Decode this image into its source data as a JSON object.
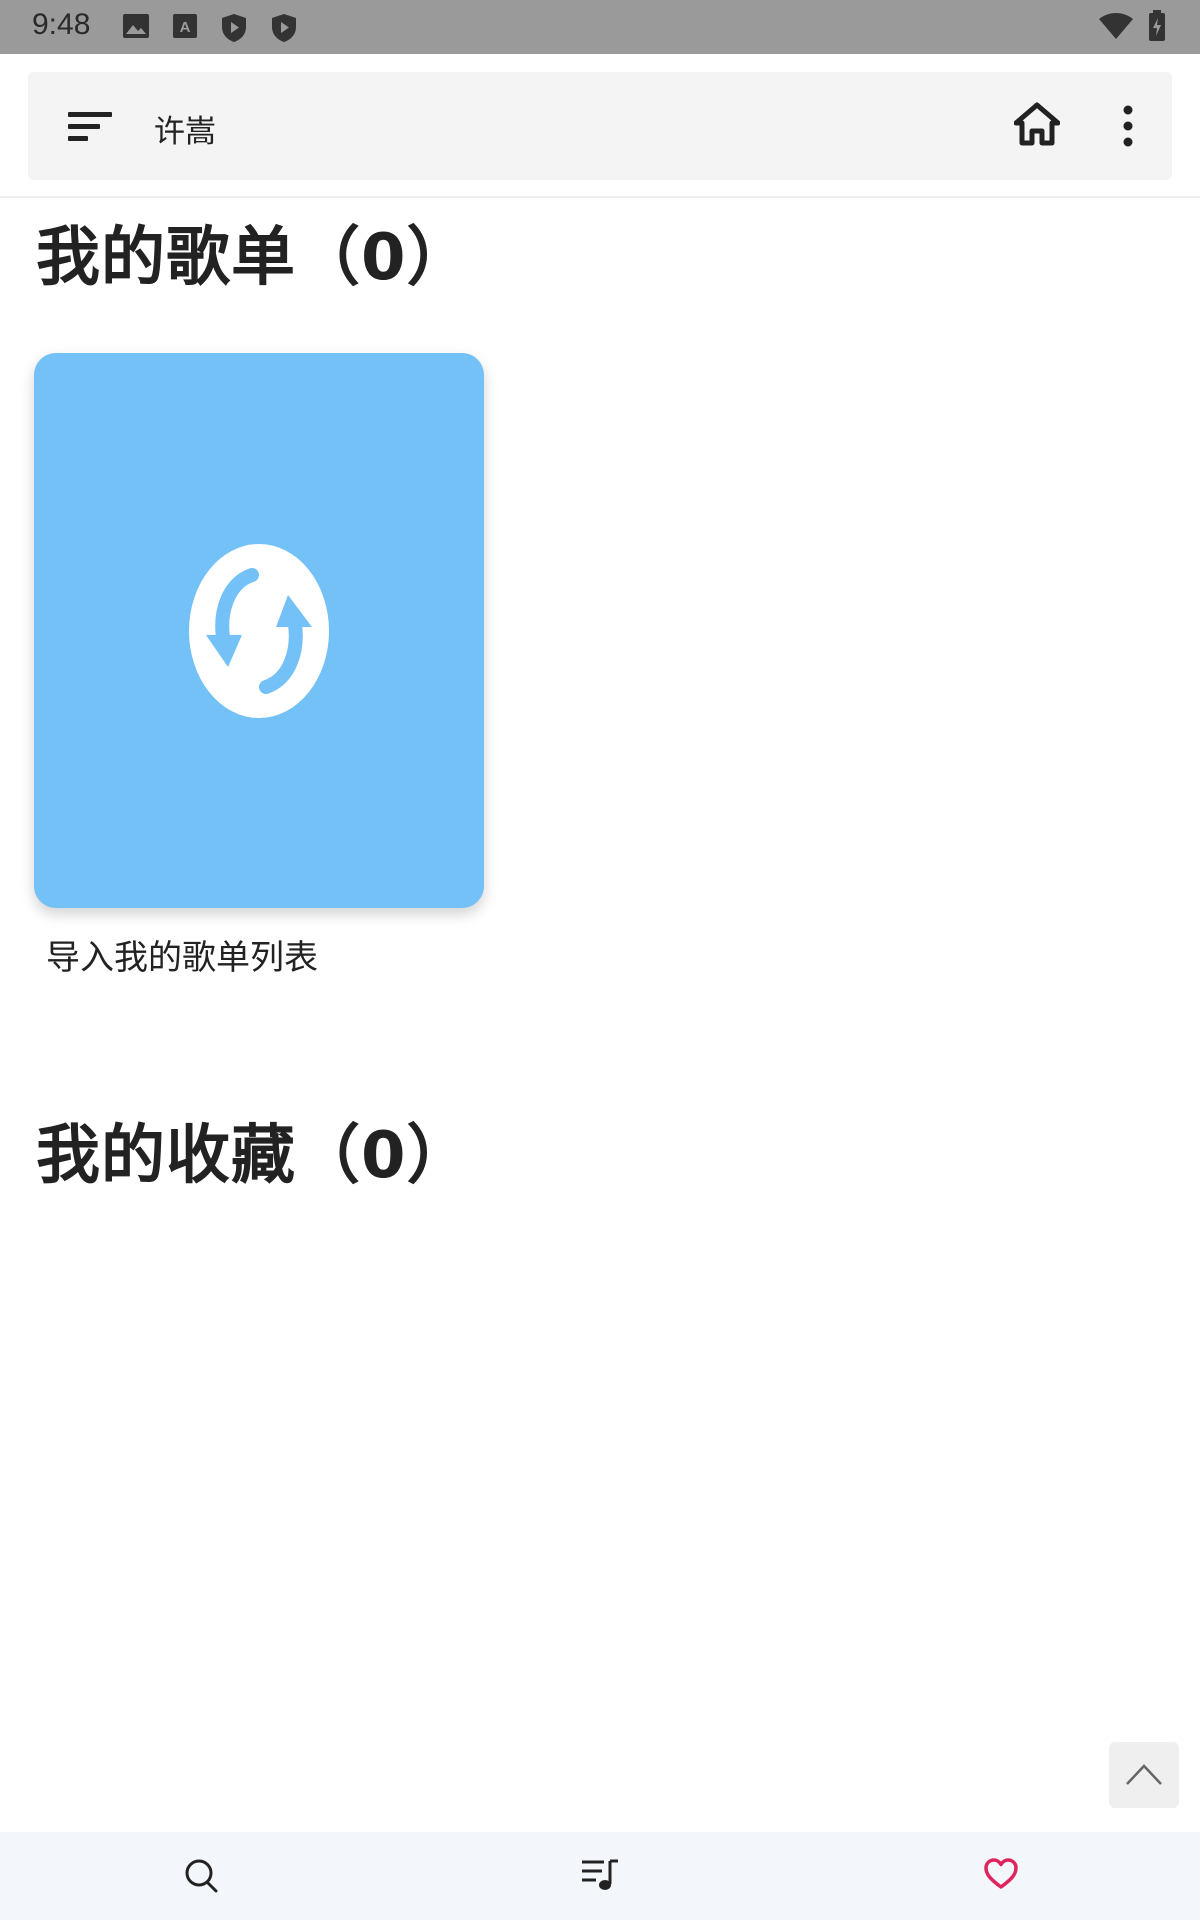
{
  "status_bar": {
    "time": "9:48",
    "icons": [
      "image-icon",
      "font-icon",
      "play-shield-icon",
      "shield-icon",
      "wifi-icon",
      "battery-charging-icon"
    ]
  },
  "app_bar": {
    "menu_icon": "sort-menu-icon",
    "title": "许嵩",
    "home_icon": "home-icon",
    "more_icon": "more-vertical-icon"
  },
  "my_playlists": {
    "title": "我的歌单（0）",
    "import_card": {
      "icon": "sync-icon",
      "caption": "导入我的歌单列表",
      "color": "#73c1f6"
    }
  },
  "my_favorites": {
    "title": "我的收藏（0）"
  },
  "back_to_top": {
    "icon": "chevron-up-icon"
  },
  "bottom_nav": {
    "items": [
      {
        "icon": "search-icon"
      },
      {
        "icon": "playlist-music-icon"
      },
      {
        "icon": "heart-icon",
        "active": true,
        "color": "#e0245e"
      }
    ]
  }
}
